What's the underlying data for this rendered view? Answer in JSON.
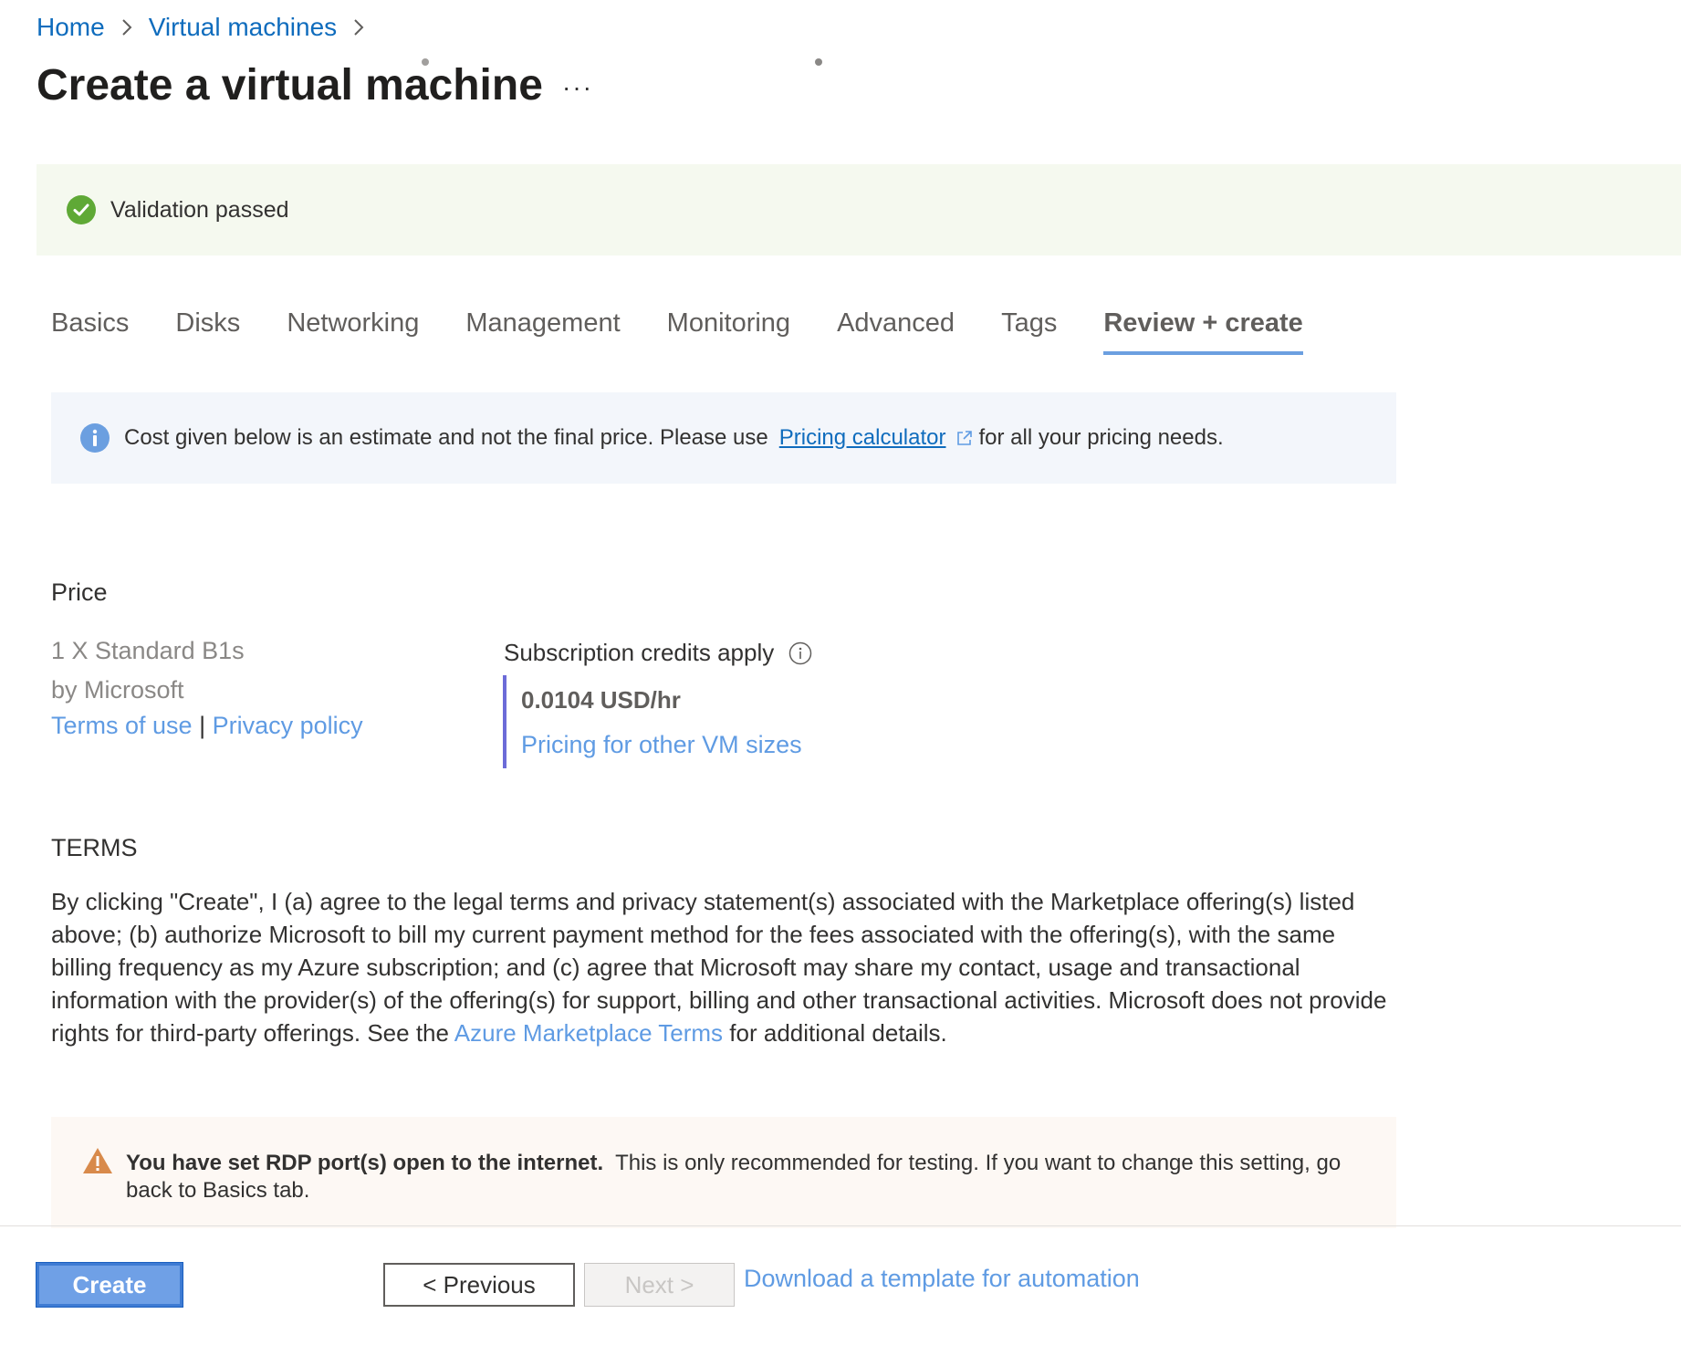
{
  "breadcrumb": {
    "items": [
      {
        "label": "Home"
      },
      {
        "label": "Virtual machines"
      }
    ]
  },
  "header": {
    "title": "Create a virtual machine",
    "more_label": "···"
  },
  "validation": {
    "text": "Validation passed",
    "color": "#5fa936"
  },
  "tabs": [
    {
      "label": "Basics",
      "active": false
    },
    {
      "label": "Disks",
      "active": false
    },
    {
      "label": "Networking",
      "active": false
    },
    {
      "label": "Management",
      "active": false
    },
    {
      "label": "Monitoring",
      "active": false
    },
    {
      "label": "Advanced",
      "active": false
    },
    {
      "label": "Tags",
      "active": false
    },
    {
      "label": "Review + create",
      "active": true
    }
  ],
  "info_bar": {
    "text_before": "Cost given below is an estimate and not the final price. Please use",
    "link_label": "Pricing calculator",
    "text_after": "for all your pricing needs."
  },
  "price": {
    "section_title": "Price",
    "plan_name": "1 X Standard B1s",
    "publisher": "by Microsoft",
    "terms_of_use": "Terms of use",
    "separator": "|",
    "privacy_policy": "Privacy policy",
    "credits_label": "Subscription credits apply",
    "amount": "0.0104 USD/hr",
    "other_sizes_link": "Pricing for other VM sizes"
  },
  "terms": {
    "title": "TERMS",
    "body": "By clicking \"Create\", I (a) agree to the legal terms and privacy statement(s) associated with the Marketplace offering(s) listed above; (b) authorize Microsoft to bill my current payment method for the fees associated with the offering(s), with the same billing frequency as my Azure subscription; and (c) agree that Microsoft may share my contact, usage and transactional information with the provider(s) of the offering(s) for support, billing and other transactional activities. Microsoft does not provide rights for third-party offerings. See the",
    "link_label": "Azure Marketplace Terms",
    "body_after": "for additional details."
  },
  "warning": {
    "bold_text": "You have set RDP port(s) open to the internet.",
    "text": "This is only recommended for testing.  If you want to change this setting, go back to Basics tab.",
    "color": "#d88a4b"
  },
  "footer": {
    "create_label": "Create",
    "previous_label": "< Previous",
    "next_label": "Next >",
    "download_link": "Download a template for automation"
  },
  "icons": {
    "validation": "check-circle-icon",
    "info": "info-icon",
    "external_link": "external-link-icon",
    "credits_info": "info-outline-icon",
    "warning": "warning-triangle-icon",
    "breadcrumb_separator": "chevron-right-icon"
  }
}
